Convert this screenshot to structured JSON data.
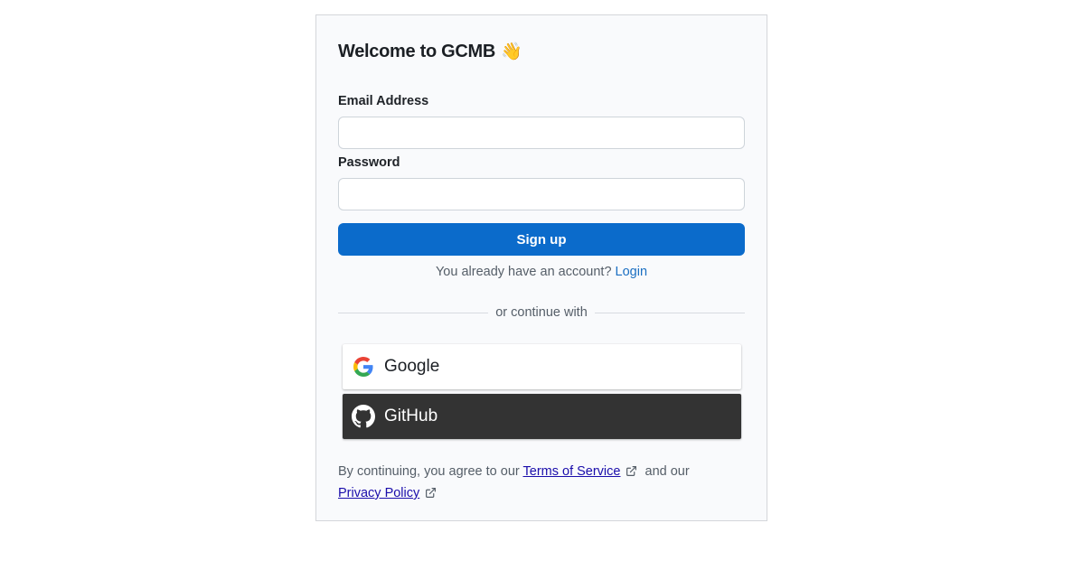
{
  "card": {
    "title": "Welcome to GCMB",
    "title_emoji": "👋"
  },
  "form": {
    "email_label": "Email Address",
    "email_value": "",
    "email_placeholder": "",
    "password_label": "Password",
    "password_value": "",
    "password_placeholder": "",
    "submit_label": "Sign up"
  },
  "account": {
    "prompt": "You already have an account?",
    "login_link": "Login"
  },
  "divider": {
    "text": "or continue with"
  },
  "oauth": {
    "google_label": "Google",
    "github_label": "GitHub"
  },
  "terms": {
    "prefix": "By continuing, you agree to our",
    "tos_link": "Terms of Service",
    "middle": "and our",
    "privacy_link": "Privacy Policy"
  },
  "icons": {
    "google": "google-icon",
    "github": "github-icon",
    "external": "external-link-icon"
  },
  "colors": {
    "primary": "#0b6bcb",
    "link": "#1b6fc2",
    "github_bg": "#333333",
    "card_bg": "#f9fafc"
  }
}
